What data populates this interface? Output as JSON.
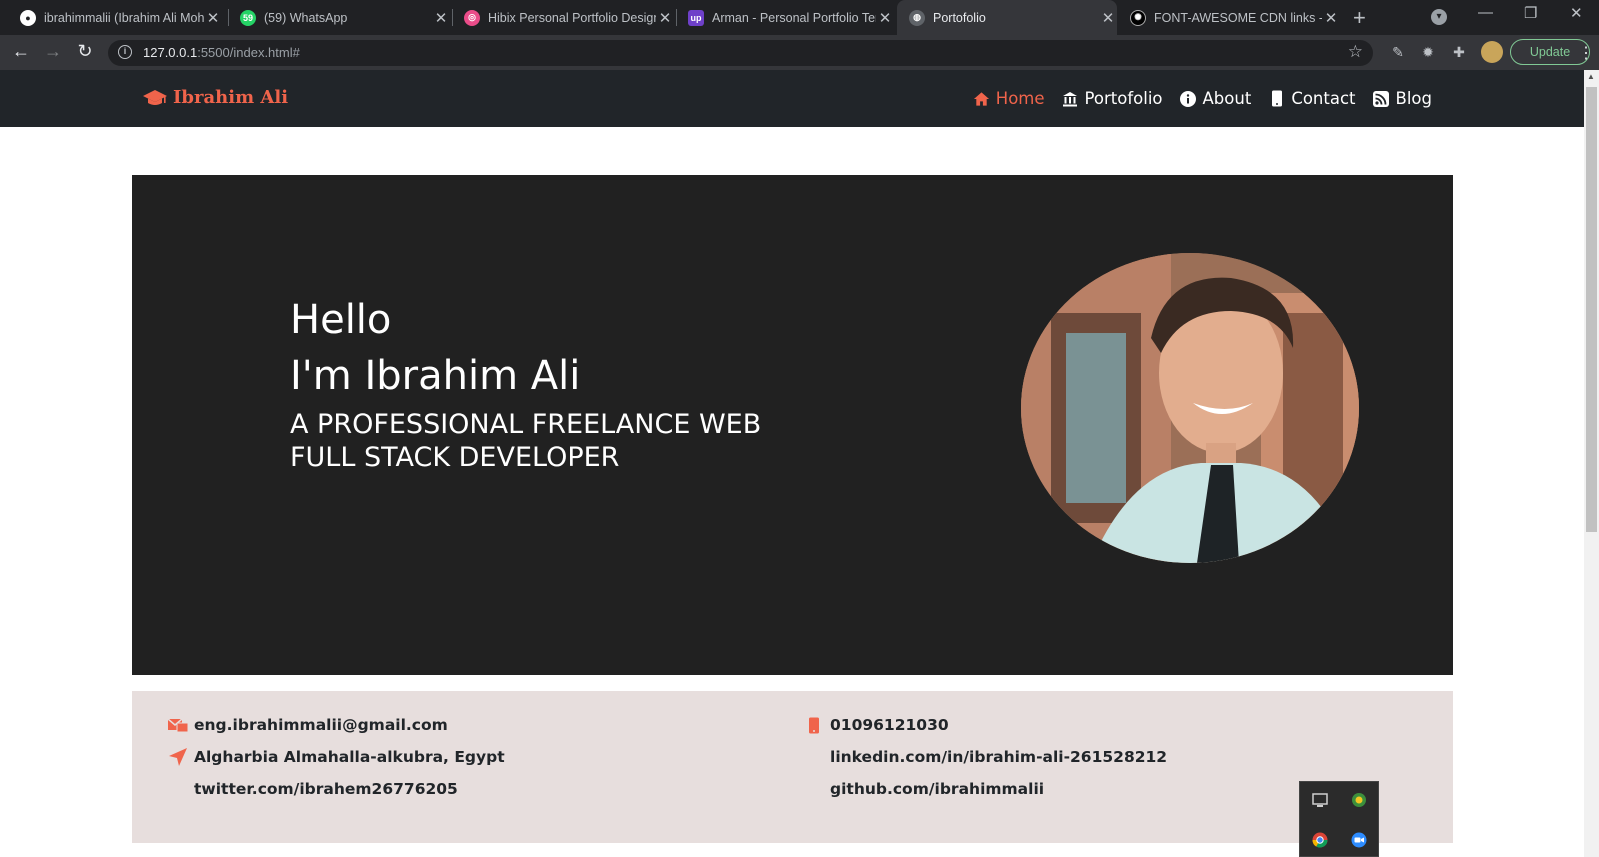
{
  "browser": {
    "tabs": [
      {
        "title": "ibrahimmalii (Ibrahim Ali Mohammed)",
        "favicon": "github-icon",
        "color": "#ffffff"
      },
      {
        "title": "(59) WhatsApp",
        "favicon": "whatsapp-icon",
        "color": "#25d366"
      },
      {
        "title": "Hibix Personal Portfolio Design",
        "favicon": "dribbble-icon",
        "color": "#ea4c89"
      },
      {
        "title": "Arman - Personal Portfolio Template",
        "favicon": "upwork-icon",
        "color": "#6e40c9"
      },
      {
        "title": "Portofolio",
        "favicon": "globe-icon",
        "color": "#bdc1c6",
        "active": true
      },
      {
        "title": "FONT-AWESOME CDN links - cdnjs",
        "favicon": "cdnjs-icon",
        "color": "#ffffff"
      }
    ],
    "url_host": "127.0.0.1",
    "url_rest": ":5500/index.html#",
    "update_label": "Update"
  },
  "site": {
    "brand": "Ibrahim Ali",
    "brand_icon": "graduation-cap-icon",
    "accent": "#f0644b",
    "nav": [
      {
        "label": "Home",
        "icon": "home-icon",
        "active": true
      },
      {
        "label": "Portofolio",
        "icon": "bank-icon",
        "active": false
      },
      {
        "label": "About",
        "icon": "info-circle-icon",
        "active": false
      },
      {
        "label": "Contact",
        "icon": "mobile-icon",
        "active": false
      },
      {
        "label": "Blog",
        "icon": "rss-icon",
        "active": false
      }
    ]
  },
  "hero": {
    "greeting": "Hello",
    "name_line": "I'm Ibrahim Ali",
    "role_line1": "A PROFESSIONAL FREELANCE WEB",
    "role_line2": "FULL STACK DEVELOPER",
    "photo": "profile-photo"
  },
  "contact": {
    "email": "eng.ibrahimmalii@gmail.com",
    "phone": "01096121030",
    "address": "Algharbia Almahalla-alkubra, Egypt",
    "linkedin": "linkedin.com/in/ibrahim-ali-261528212",
    "twitter": "twitter.com/ibrahem26776205",
    "github": "github.com/ibrahimmalii"
  }
}
